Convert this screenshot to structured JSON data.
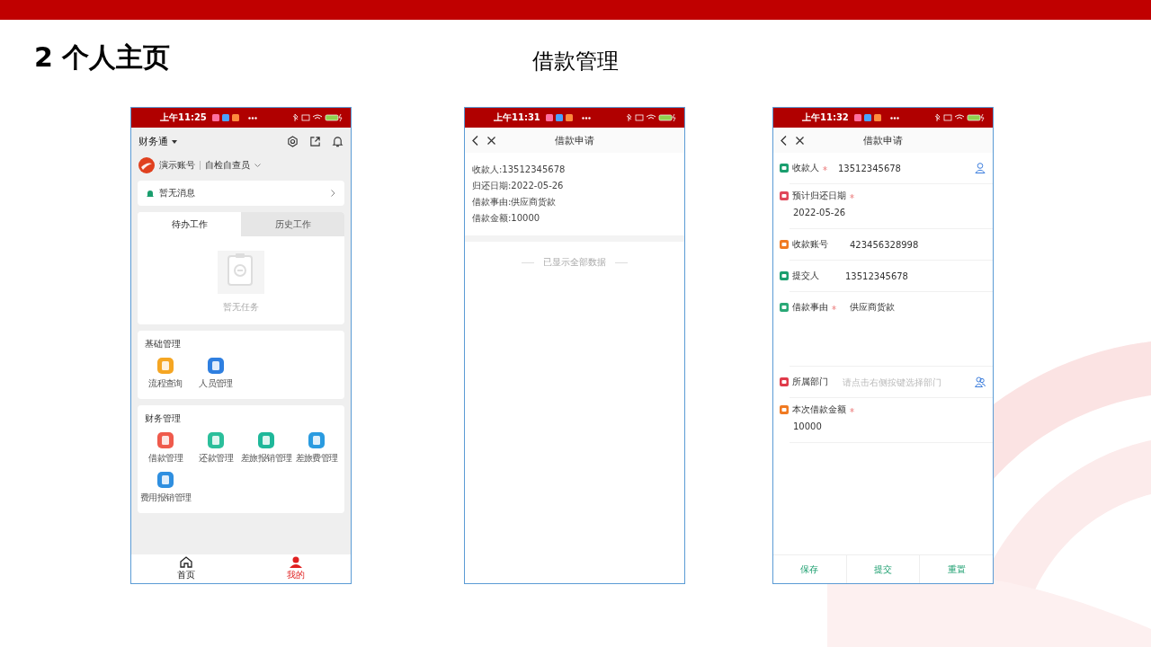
{
  "slide": {
    "title": "2 个人主页",
    "heading": "借款管理"
  },
  "phone_home": {
    "status_time": "上午11:25",
    "app_title": "财务通",
    "account": "演示账号",
    "role": "自检自查员",
    "notice": "暂无消息",
    "tabs": [
      {
        "label": "待办工作",
        "selected": true
      },
      {
        "label": "历史工作",
        "selected": false
      }
    ],
    "empty_text": "暂无任务",
    "sections": [
      {
        "title": "基础管理",
        "items": [
          {
            "label": "流程查询",
            "color": "#f5a623"
          },
          {
            "label": "人员管理",
            "color": "#2f7fe0"
          }
        ]
      },
      {
        "title": "财务管理",
        "items": [
          {
            "label": "借款管理",
            "color": "#ef5a4c"
          },
          {
            "label": "还款管理",
            "color": "#2bbf9b"
          },
          {
            "label": "差旅报销管理",
            "color": "#1fb89a"
          },
          {
            "label": "差旅费管理",
            "color": "#2a9be0"
          },
          {
            "label": "费用报销管理",
            "color": "#2f8fe0"
          }
        ]
      }
    ],
    "bottom_nav": [
      {
        "label": "首页",
        "selected": false
      },
      {
        "label": "我的",
        "selected": true
      }
    ]
  },
  "phone_list": {
    "status_time": "上午11:31",
    "nav_title": "借款申请",
    "lines": [
      "收款人:13512345678",
      "归还日期:2022-05-26",
      "借款事由:供应商货款",
      "借款金额:10000"
    ],
    "footer": "已显示全部数据"
  },
  "phone_form": {
    "status_time": "上午11:32",
    "nav_title": "借款申请",
    "fields": [
      {
        "kind": "person",
        "label": "收款人",
        "required": true,
        "value": "13512345678",
        "color": "#1a9e6e"
      },
      {
        "kind": "stacked",
        "label": "预计归还日期",
        "required": true,
        "value": "2022-05-26",
        "color": "#e0475a"
      },
      {
        "kind": "inline",
        "label": "收款账号",
        "required": false,
        "value": "423456328998",
        "color": "#f07a22"
      },
      {
        "kind": "inline",
        "label": "提交人",
        "required": false,
        "value": "13512345678",
        "color": "#1a9e6e"
      },
      {
        "kind": "textarea",
        "label": "借款事由",
        "required": true,
        "value": "供应商货款",
        "color": "#2aa876"
      },
      {
        "kind": "group",
        "label": "所属部门",
        "required": false,
        "placeholder": "请点击右侧按键选择部门",
        "color": "#e03a4a"
      },
      {
        "kind": "stacked",
        "label": "本次借款金额",
        "required": true,
        "value": "10000",
        "color": "#f07a22"
      }
    ],
    "buttons": [
      "保存",
      "提交",
      "重置"
    ]
  }
}
